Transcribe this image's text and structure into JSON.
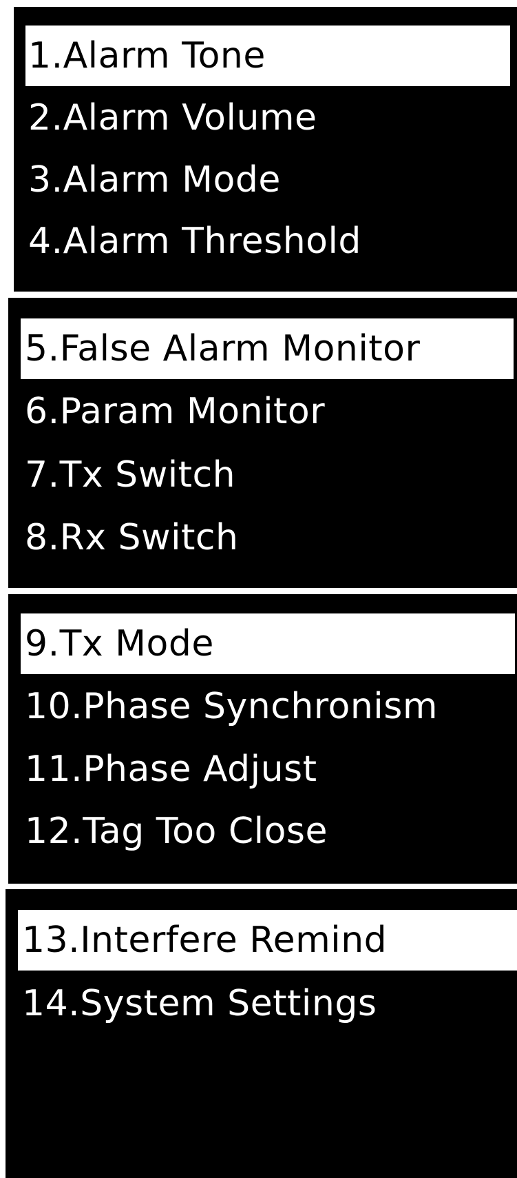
{
  "colors": {
    "screen_background": "#000000",
    "item_text": "#ffffff",
    "selected_background": "#ffffff",
    "selected_text": "#000000"
  },
  "screens": [
    {
      "items": [
        {
          "label": "1.Alarm Tone",
          "selected": true
        },
        {
          "label": "2.Alarm Volume",
          "selected": false
        },
        {
          "label": "3.Alarm Mode",
          "selected": false
        },
        {
          "label": "4.Alarm Threshold",
          "selected": false
        }
      ]
    },
    {
      "items": [
        {
          "label": "5.False Alarm Monitor",
          "selected": true
        },
        {
          "label": "6.Param Monitor",
          "selected": false
        },
        {
          "label": "7.Tx Switch",
          "selected": false
        },
        {
          "label": "8.Rx Switch",
          "selected": false
        }
      ]
    },
    {
      "items": [
        {
          "label": "9.Tx Mode",
          "selected": true
        },
        {
          "label": "10.Phase Synchronism",
          "selected": false
        },
        {
          "label": "11.Phase Adjust",
          "selected": false
        },
        {
          "label": "12.Tag Too Close",
          "selected": false
        }
      ]
    },
    {
      "items": [
        {
          "label": "13.Interfere Remind",
          "selected": true
        },
        {
          "label": "14.System Settings",
          "selected": false
        }
      ]
    }
  ]
}
